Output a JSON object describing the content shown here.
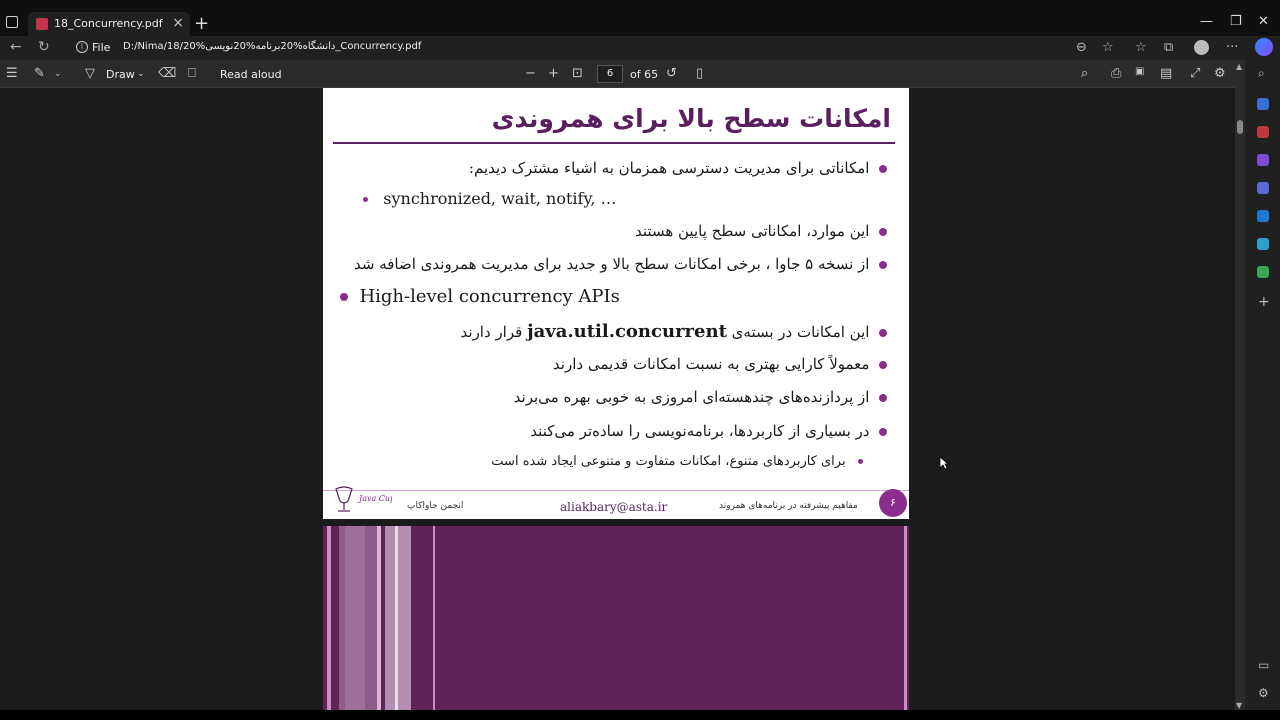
{
  "browser": {
    "tab_title": "18_Concurrency.pdf",
    "tab_close": "×",
    "new_tab": "+",
    "minimize": "—",
    "maximize": "❐",
    "close": "✕",
    "back": "←",
    "refresh": "↻",
    "info_glyph": "i",
    "address_label": "File",
    "address_url": "D:/Nima/18/دانشگاه%20برنامه%20نویسی%20_Concurrency.pdf",
    "menu": "···"
  },
  "pdf_toolbar": {
    "contents": "☰",
    "highlight": "✎",
    "draw_label": "Draw",
    "erase": "⌫",
    "read_aloud_label": "Read aloud",
    "zoom_out": "−",
    "zoom_in": "+",
    "page_current": "6",
    "page_total": "of 65",
    "search": "⌕",
    "print": "⎙",
    "save": "💾",
    "settings": "⚙"
  },
  "slide": {
    "title": "امکانات سطح بالا برای همروندی",
    "bullets": [
      {
        "level": 1,
        "dir": "rtl",
        "text": "امکاناتی برای مدیریت دسترسی همزمان به اشیاء مشترک دیدیم:"
      },
      {
        "level": 2,
        "dir": "ltr",
        "text": "synchronized, wait, notify, …"
      },
      {
        "level": 1,
        "dir": "rtl",
        "text": "این موارد، امکاناتی سطح پایین هستند"
      },
      {
        "level": 1,
        "dir": "rtl",
        "text": "از نسخه ۵ جاوا ، برخی امکانات سطح بالا و جدید برای مدیریت همروندی اضافه شد"
      },
      {
        "level": 0,
        "dir": "ltr",
        "text": "High-level concurrency APIs"
      },
      {
        "level": 1,
        "dir": "rtl",
        "text_before": "این امکانات در بسته‌ی",
        "code": "java.util.concurrent",
        "text_after": "قرار دارند"
      },
      {
        "level": 1,
        "dir": "rtl",
        "text": "معمولاً کارایی بهتری به نسبت امکانات قدیمی دارند"
      },
      {
        "level": 1,
        "dir": "rtl",
        "text": "از پردازنده‌های چندهسته‌ای امروزی به خوبی بهره می‌برند"
      },
      {
        "level": 1,
        "dir": "rtl",
        "text": "در بسیاری از کاربردها، برنامه‌نویسی را ساده‌تر می‌کنند"
      },
      {
        "level": 2,
        "dir": "rtl",
        "text": "برای کاربردهای متنوع، امکانات متفاوت و متنوعی ایجاد شده است"
      }
    ],
    "footer_left": "انجمن جاواکاپ",
    "logo_text": "Java Cup",
    "footer_email": "aliakbary@asta.ir",
    "footer_right": "مفاهیم پیشرفته در برنامه‌های همروند",
    "page_number": "۶"
  },
  "colors": {
    "accent_purple": "#5a1f5e",
    "bullet_purple": "#8b2d8f",
    "next_slide_bg": "#5e2357"
  }
}
